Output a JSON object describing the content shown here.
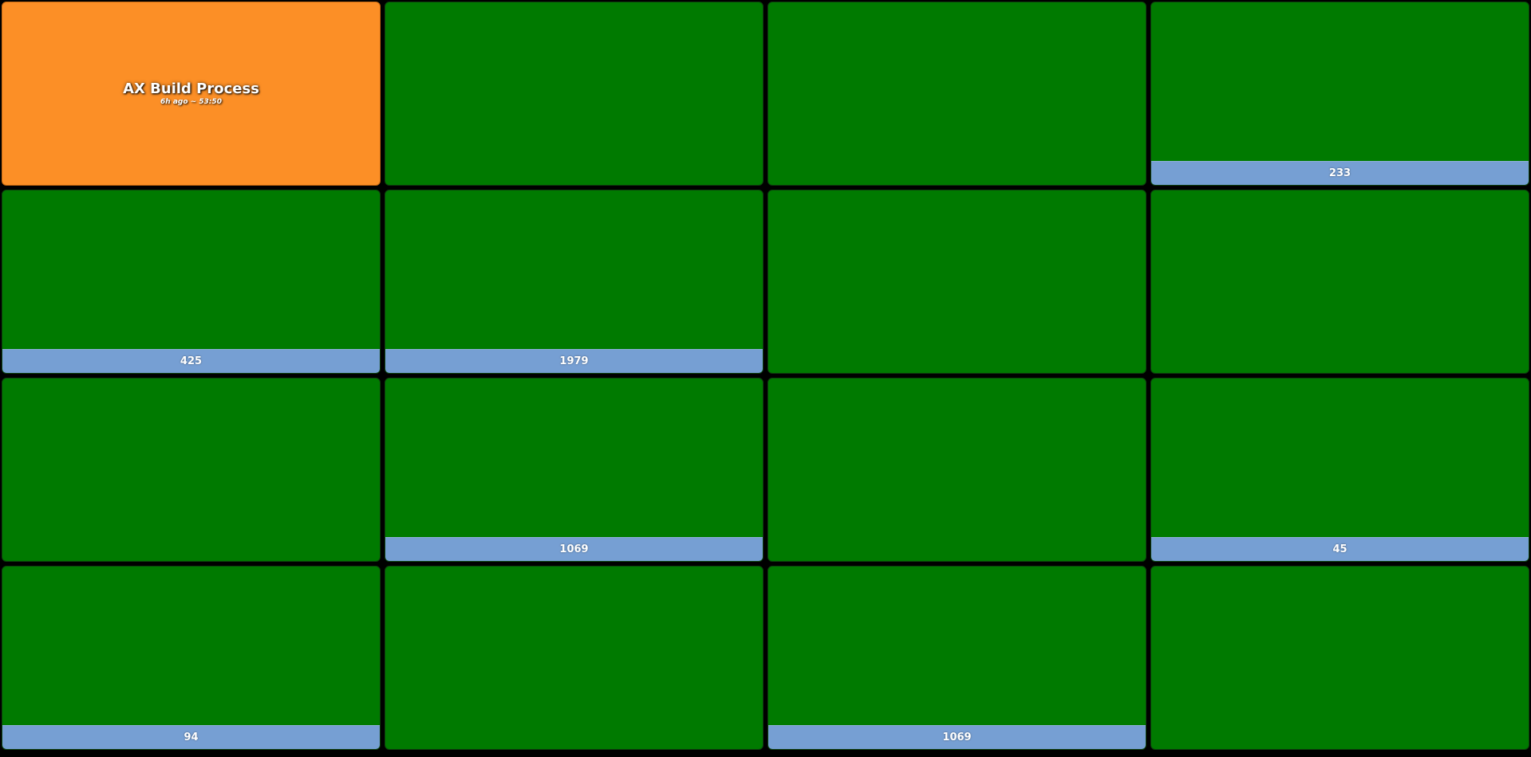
{
  "colors": {
    "background": "#000000",
    "ok": "#007a00",
    "warn": "#fc8f26",
    "footer": "#769fd3"
  },
  "tiles": [
    {
      "title": "AX Build Process",
      "subtitle": "6h ago ~ 53:50",
      "footer": null,
      "status": "warn"
    },
    {
      "title": "",
      "subtitle": "",
      "footer": null,
      "status": "ok"
    },
    {
      "title": "",
      "subtitle": "",
      "footer": null,
      "status": "ok"
    },
    {
      "title": "",
      "subtitle": "",
      "footer": "233",
      "status": "ok"
    },
    {
      "title": "",
      "subtitle": "",
      "footer": "425",
      "status": "ok"
    },
    {
      "title": "",
      "subtitle": "",
      "footer": "1979",
      "status": "ok"
    },
    {
      "title": "",
      "subtitle": "",
      "footer": null,
      "status": "ok"
    },
    {
      "title": "",
      "subtitle": "",
      "footer": null,
      "status": "ok"
    },
    {
      "title": "",
      "subtitle": "",
      "footer": null,
      "status": "ok"
    },
    {
      "title": "",
      "subtitle": "",
      "footer": "1069",
      "status": "ok"
    },
    {
      "title": "",
      "subtitle": "",
      "footer": null,
      "status": "ok"
    },
    {
      "title": "",
      "subtitle": "",
      "footer": "45",
      "status": "ok"
    },
    {
      "title": "",
      "subtitle": "",
      "footer": "94",
      "status": "ok"
    },
    {
      "title": "",
      "subtitle": "",
      "footer": null,
      "status": "ok"
    },
    {
      "title": "",
      "subtitle": "",
      "footer": "1069",
      "status": "ok"
    },
    {
      "title": "",
      "subtitle": "",
      "footer": null,
      "status": "ok"
    }
  ]
}
